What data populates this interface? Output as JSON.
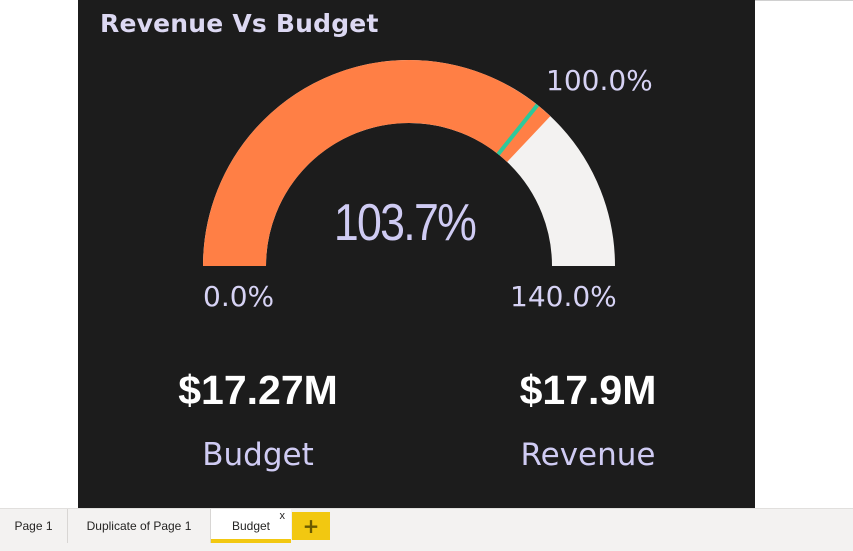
{
  "visual": {
    "title": "Revenue Vs Budget",
    "background": "#1c1c1c"
  },
  "gauge": {
    "value": 103.7,
    "min": 0,
    "max": 140,
    "target": 100,
    "value_label": "103.7%",
    "min_label": "0.0%",
    "max_label": "140.0%",
    "target_label": "100.0%",
    "colors": {
      "fill": "#ff7f45",
      "track": "#f3f2f1",
      "target": "#2dc99b"
    }
  },
  "cards": {
    "budget": {
      "value": "$17.27M",
      "label": "Budget"
    },
    "revenue": {
      "value": "$17.9M",
      "label": "Revenue"
    }
  },
  "tabs": {
    "items": [
      {
        "label": "Page 1"
      },
      {
        "label": "Duplicate of Page 1"
      },
      {
        "label": "Budget",
        "active": true
      }
    ],
    "close_glyph": "x",
    "add_glyph": "+"
  }
}
